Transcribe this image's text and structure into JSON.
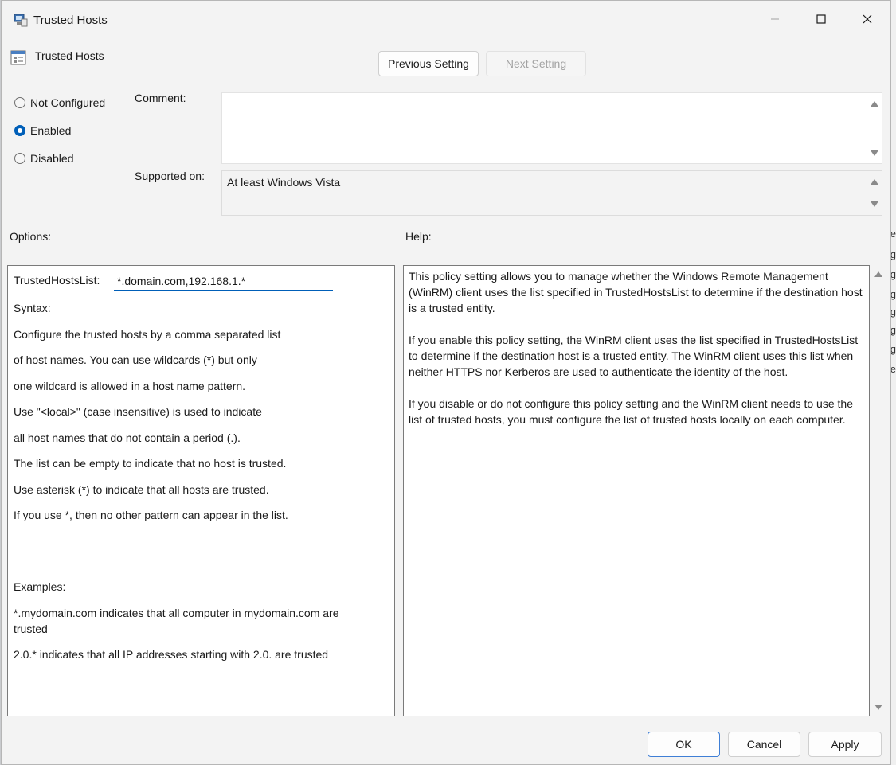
{
  "window": {
    "title": "Trusted Hosts",
    "header_title": "Trusted Hosts"
  },
  "nav": {
    "previous": "Previous Setting",
    "next": "Next Setting"
  },
  "state": {
    "options": [
      {
        "label": "Not Configured",
        "selected": false
      },
      {
        "label": "Enabled",
        "selected": true
      },
      {
        "label": "Disabled",
        "selected": false
      }
    ]
  },
  "comment": {
    "label": "Comment:",
    "value": ""
  },
  "supported": {
    "label": "Supported on:",
    "value": "At least Windows Vista"
  },
  "options_label": "Options:",
  "help_label": "Help:",
  "options_panel": {
    "field_label": "TrustedHostsList:",
    "field_value": "*.domain.com,192.168.1.*",
    "lines": [
      "Syntax:",
      "Configure the trusted hosts by a comma separated list",
      "of host names. You can use wildcards (*) but only",
      "one wildcard is allowed in a host name pattern.",
      "Use \"<local>\" (case insensitive) is used to indicate",
      "all host names that do not contain a period (.).",
      "The list can be empty to indicate that no host is trusted.",
      "Use asterisk (*)  to indicate that all hosts are trusted.",
      "If you use *, then no other pattern can appear in the list.",
      "Examples:",
      "*.mydomain.com indicates that all computer in mydomain.com are",
      "trusted",
      "2.0.* indicates that all IP addresses starting with 2.0. are trusted"
    ]
  },
  "help_panel": {
    "paragraphs": [
      "This policy setting allows you to manage whether the Windows Remote Management (WinRM) client uses the list specified in TrustedHostsList to determine if the destination host is a trusted entity.",
      "If you enable this policy setting, the WinRM client uses the list specified in TrustedHostsList to determine if the destination host is a trusted entity. The WinRM client uses this list when neither HTTPS nor Kerberos are used to authenticate the identity of the host.",
      "If you disable or do not configure this policy setting and the WinRM client needs to use the list of trusted hosts, you must configure the list of trusted hosts locally on each computer."
    ]
  },
  "footer": {
    "ok": "OK",
    "cancel": "Cancel",
    "apply": "Apply"
  },
  "background_glyphs": [
    "e",
    "g",
    "g",
    "g",
    "g",
    "g",
    "g",
    "e"
  ],
  "colors": {
    "accent": "#005fb8",
    "window": "#f3f3f3"
  }
}
